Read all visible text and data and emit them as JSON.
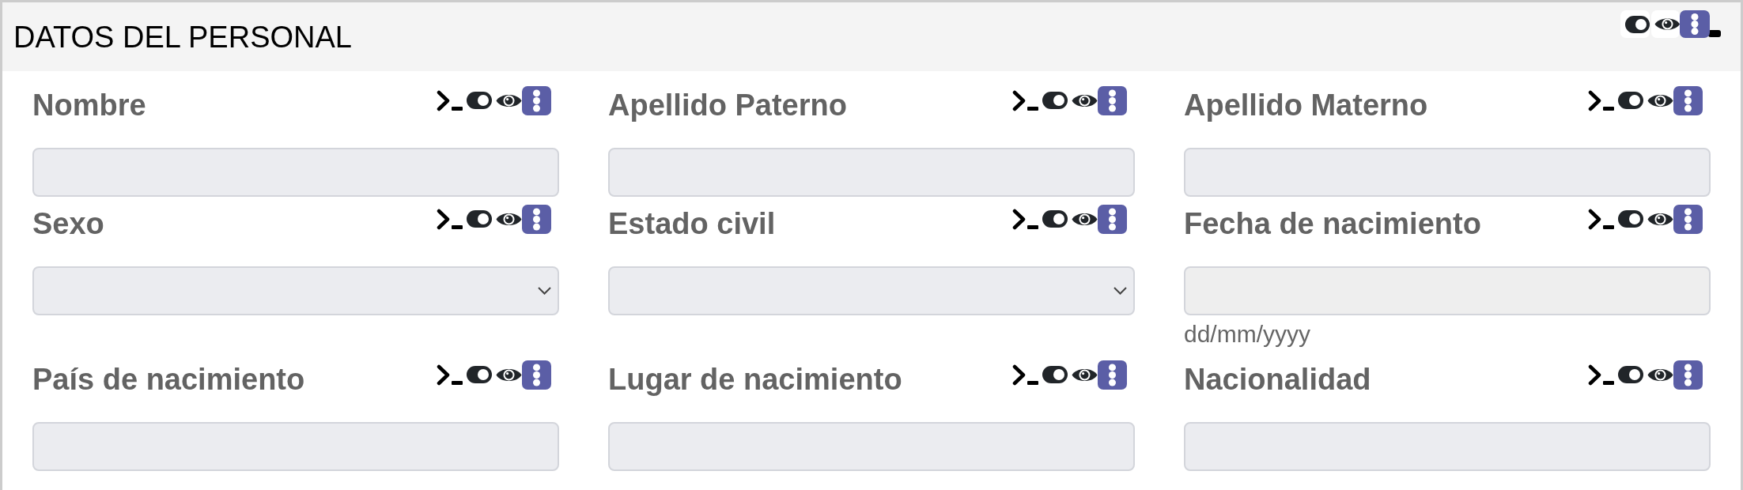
{
  "panel": {
    "title": "DATOS DEL PERSONAL",
    "toggle_on": true
  },
  "fields": [
    {
      "label": "Nombre",
      "kind": "text",
      "toggle_on": true
    },
    {
      "label": "Apellido Paterno",
      "kind": "text",
      "toggle_on": true
    },
    {
      "label": "Apellido Materno",
      "kind": "text",
      "toggle_on": true
    },
    {
      "label": "Sexo",
      "kind": "select",
      "toggle_on": true
    },
    {
      "label": "Estado civil",
      "kind": "select",
      "toggle_on": true
    },
    {
      "label": "Fecha de nacimiento",
      "kind": "date",
      "hint": "dd/mm/yyyy",
      "toggle_on": true
    },
    {
      "label": "País de nacimiento",
      "kind": "text",
      "toggle_on": true
    },
    {
      "label": "Lugar de nacimiento",
      "kind": "text",
      "toggle_on": true
    },
    {
      "label": "Nacionalidad",
      "kind": "text",
      "toggle_on": true
    }
  ]
}
